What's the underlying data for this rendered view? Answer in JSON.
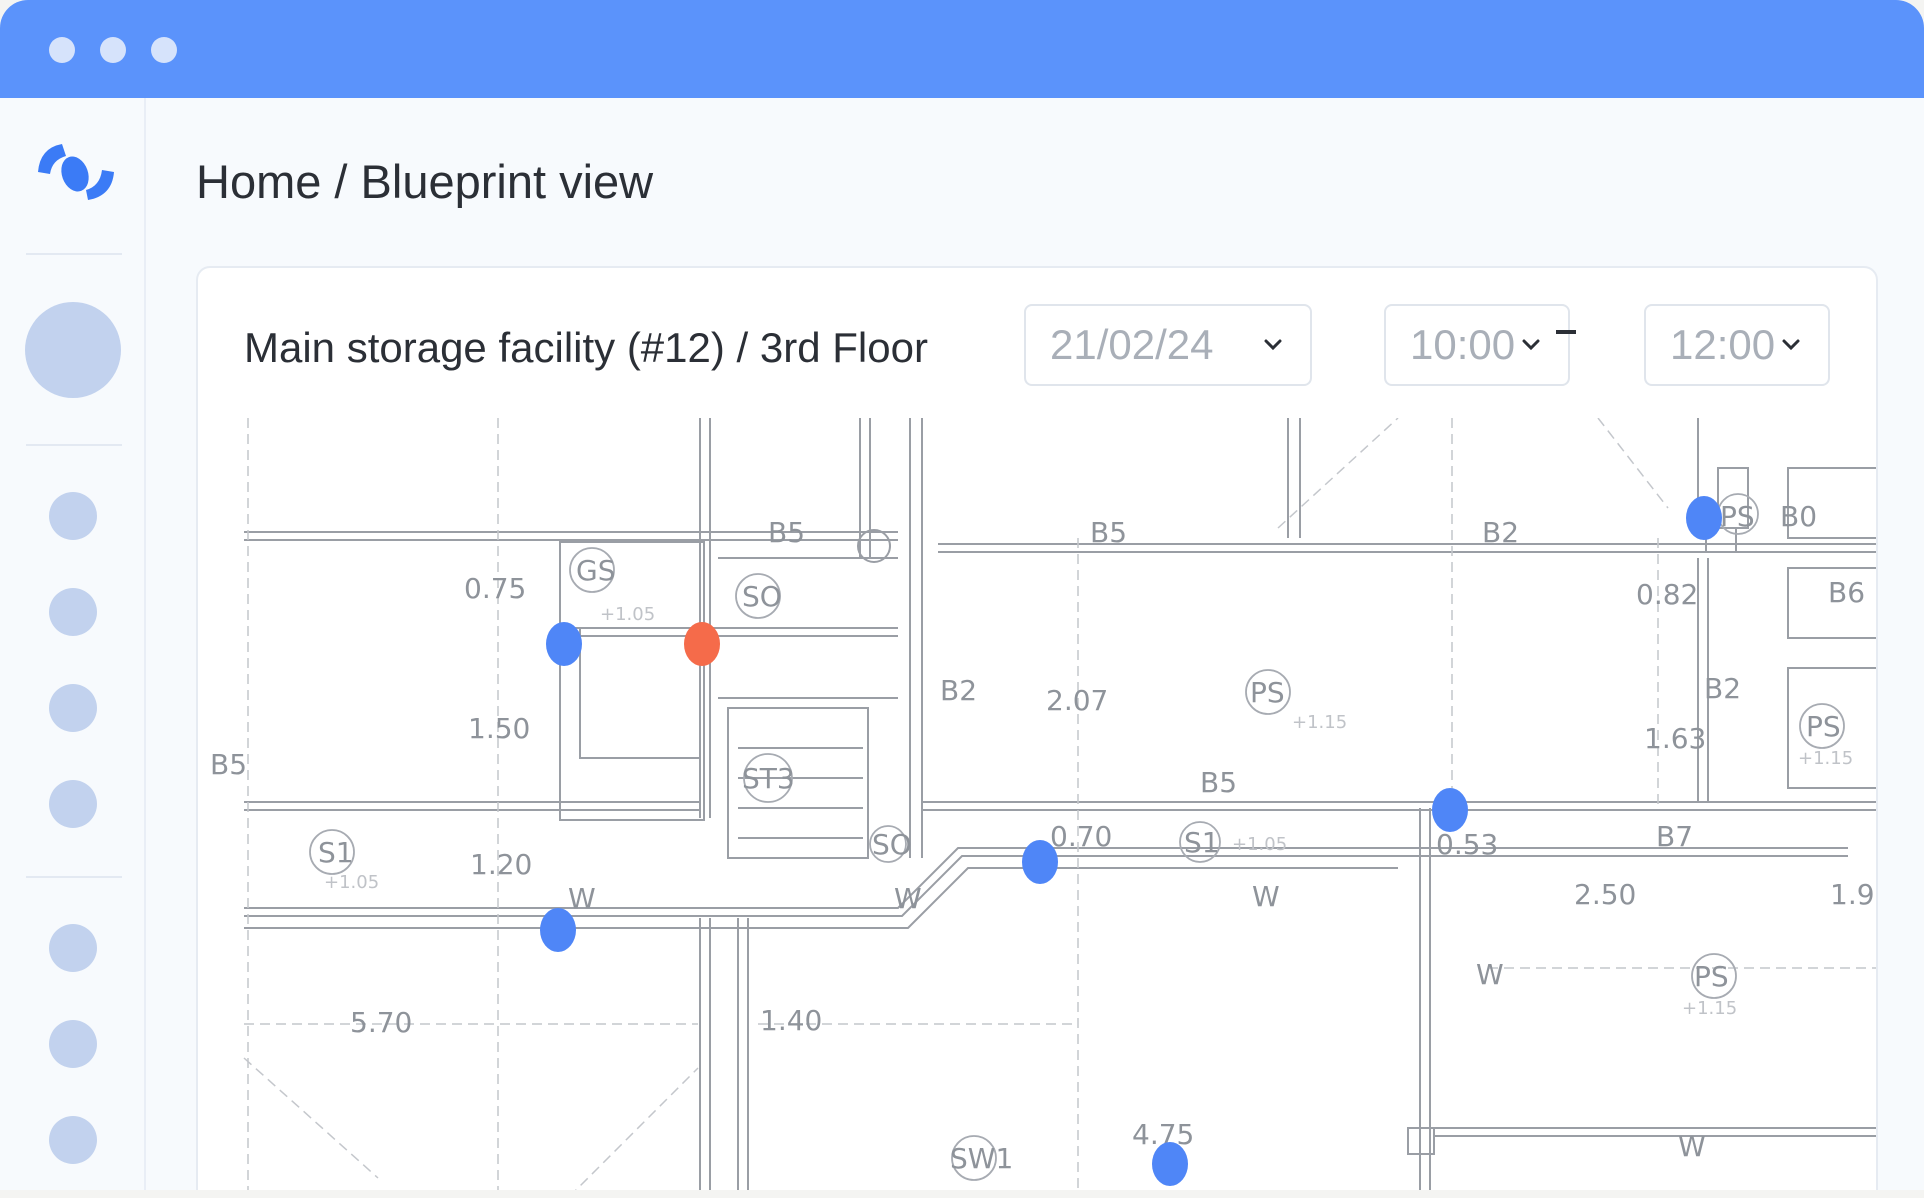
{
  "header": {
    "breadcrumb": "Home / Blueprint view"
  },
  "card": {
    "facility": "Main storage facility (#12) / 3rd Floor",
    "date": "21/02/24",
    "time_from": "10:00",
    "time_to": "12:00"
  },
  "blueprint_labels": {
    "b5_a": "B5",
    "b5_b": "B5",
    "b2_a": "B2",
    "b0": "B0",
    "b6": "B6",
    "b5_left": "B5",
    "b2_mid": "B2",
    "b2_right": "B2",
    "b5_mid": "B5",
    "b7": "B7",
    "gs": "GS",
    "so_a": "SO",
    "so_b": "SO",
    "st3": "ST3",
    "ps_a": "PS",
    "ps_b": "PS",
    "ps_c": "PS",
    "ps_d": "PS",
    "s1_a": "S1",
    "s1_b": "S1",
    "sw1": "SW1",
    "d075": "0.75",
    "d150": "1.50",
    "d120": "1.20",
    "d570": "5.70",
    "d140": "1.40",
    "d207": "2.07",
    "d070": "0.70",
    "d053": "0.53",
    "d082": "0.82",
    "d163": "1.63",
    "d250": "2.50",
    "d19": "1.9",
    "d475": "4.75",
    "e105a": "+1.05",
    "e105b": "+1.05",
    "e105c": "+1.05",
    "e115a": "+1.15",
    "e115b": "+1.15",
    "e115c": "+1.15",
    "w1": "W",
    "w2": "W",
    "w3": "W",
    "w4": "W",
    "w5": "W"
  },
  "markers": [
    {
      "id": "marker-1",
      "status": "normal",
      "color": "#4f86f7"
    },
    {
      "id": "marker-2",
      "status": "alert",
      "color": "#f56b4a"
    },
    {
      "id": "marker-3",
      "status": "normal",
      "color": "#4f86f7"
    },
    {
      "id": "marker-4",
      "status": "normal",
      "color": "#4f86f7"
    },
    {
      "id": "marker-5",
      "status": "normal",
      "color": "#4f86f7"
    },
    {
      "id": "marker-6",
      "status": "normal",
      "color": "#4f86f7"
    },
    {
      "id": "marker-7",
      "status": "normal",
      "color": "#4f86f7"
    }
  ],
  "colors": {
    "titlebar": "#5b93fb",
    "marker_normal": "#4f86f7",
    "marker_alert": "#f56b4a",
    "nav_dot": "#c2d2ee"
  },
  "icons": {
    "logo": "brand-logo-icon",
    "date_chevron": "chevron-down-icon",
    "window_controls": "window-dot-icon"
  }
}
